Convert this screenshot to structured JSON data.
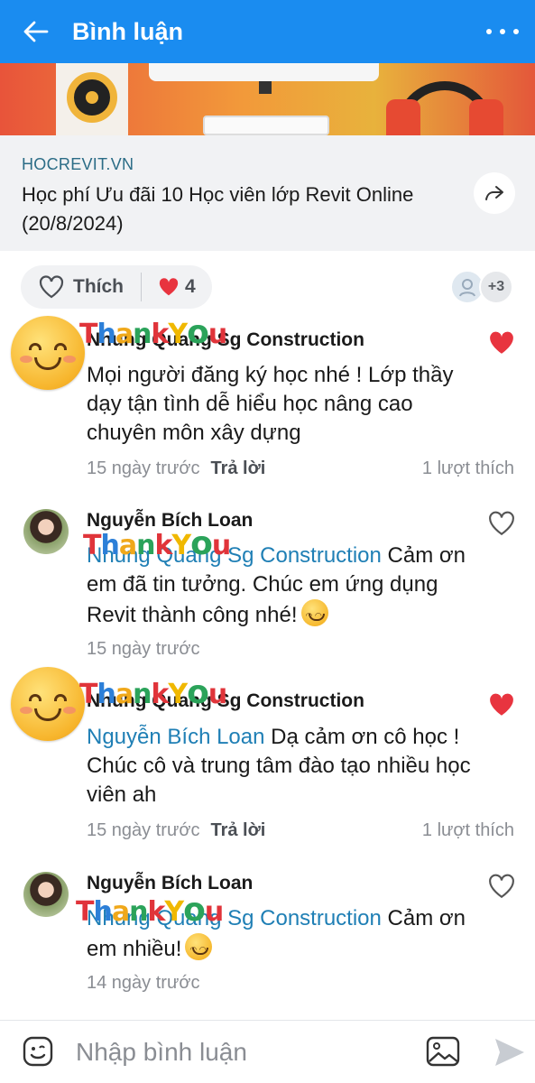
{
  "header": {
    "title": "Bình luận"
  },
  "link": {
    "domain": "HOCREVIT.VN",
    "title": "Học phí Ưu đãi 10 Học viên lớp Revit Online (20/8/2024)"
  },
  "reactions": {
    "like_label": "Thích",
    "heart_count": "4",
    "more_reactors": "+3"
  },
  "sticker_text": [
    "T",
    "h",
    "a",
    "n",
    "k",
    "Y",
    "o",
    "u"
  ],
  "comments": [
    {
      "name": "Nhung Quang Sg Construction",
      "text": "Mọi người đăng ký học nhé ! Lớp thầy dạy tận tình dễ hiểu học nâng cao chuyên môn xây dựng",
      "time": "15 ngày trước",
      "reply": "Trả lời",
      "likes": "1 lượt thích"
    },
    {
      "name": "Nguyễn Bích Loan",
      "mention": "Nhung Quang Sg Construction",
      "text": "Cảm ơn em đã tin tưởng. Chúc em ứng dụng Revit thành công nhé!",
      "time": "15 ngày trước"
    },
    {
      "name": "Nhung Quang Sg Construction",
      "mention": "Nguyễn Bích Loan",
      "text": "Dạ cảm ơn cô học ! Chúc cô và trung tâm đào tạo nhiều học viên ah",
      "time": "15 ngày trước",
      "reply": "Trả lời",
      "likes": "1 lượt thích"
    },
    {
      "name": "Nguyễn Bích Loan",
      "mention": "Nhung Quang Sg Construction",
      "text": "Cảm ơn em nhiều!",
      "time": "14 ngày trước"
    }
  ],
  "input": {
    "placeholder": "Nhập bình luận"
  },
  "colors": {
    "accent": "#1a8cf0",
    "mention": "#1f7fb5",
    "heart": "#e8343f"
  }
}
